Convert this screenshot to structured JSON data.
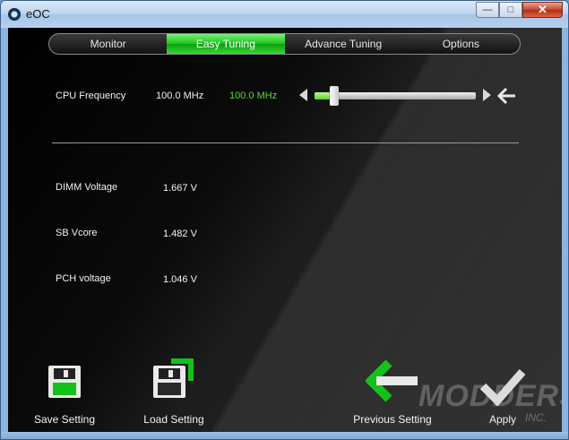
{
  "window": {
    "title": "eOC"
  },
  "caption_buttons": {
    "minimize": "—",
    "maximize": "□",
    "close": "✕"
  },
  "tabs": [
    {
      "label": "Monitor",
      "active": false
    },
    {
      "label": "Easy Tuning",
      "active": true
    },
    {
      "label": "Advance Tuning",
      "active": false
    },
    {
      "label": "Options",
      "active": false
    }
  ],
  "cpu": {
    "label": "CPU Frequency",
    "current": "100.0 MHz",
    "target": "100.0 MHz",
    "slider_fraction": 0.12
  },
  "readings": [
    {
      "label": "DIMM Voltage",
      "value": "1.667 V"
    },
    {
      "label": "SB Vcore",
      "value": "1.482 V"
    },
    {
      "label": "PCH voltage",
      "value": "1.046 V"
    }
  ],
  "actions": {
    "save": "Save Setting",
    "load": "Load Setting",
    "previous": "Previous Setting",
    "apply": "Apply"
  },
  "watermark": {
    "main": "MODDERS",
    "sub": "INC."
  },
  "colors": {
    "accent_green": "#18c318",
    "value_green": "#5bd93a",
    "background": "#0a0a0a"
  },
  "icons": {
    "app": "eoc-logo-icon",
    "save": "floppy-save-icon",
    "load": "floppy-load-icon",
    "previous": "left-arrow-icon",
    "apply": "checkmark-icon"
  }
}
